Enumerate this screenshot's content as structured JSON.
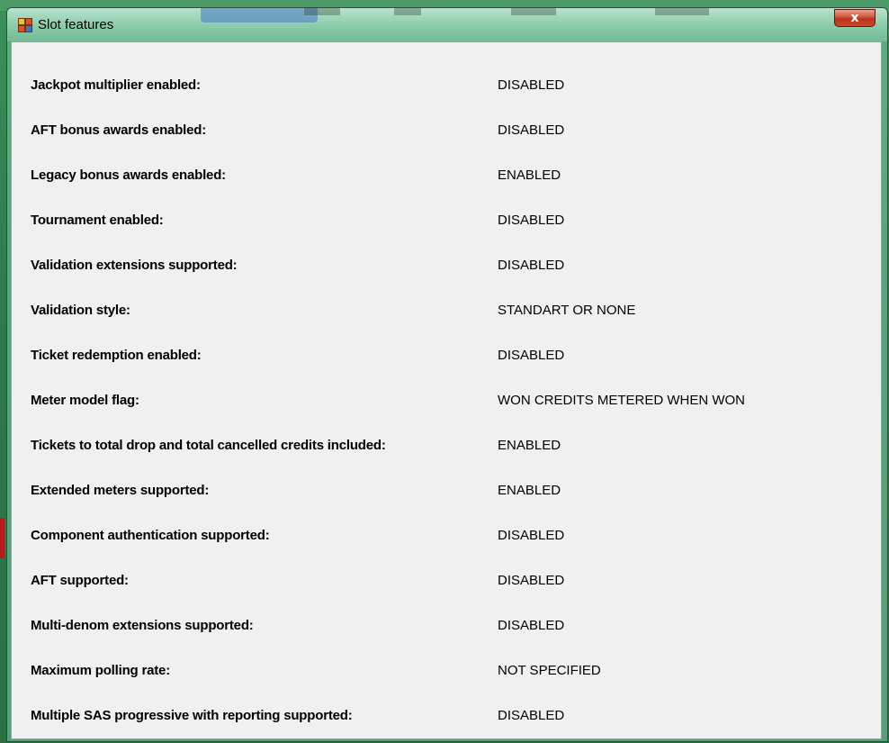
{
  "window": {
    "title": "Slot features",
    "close_label": "x"
  },
  "features": [
    {
      "label": "Jackpot multiplier enabled:",
      "value": "DISABLED"
    },
    {
      "label": "AFT bonus awards enabled:",
      "value": "DISABLED"
    },
    {
      "label": "Legacy bonus awards enabled:",
      "value": "ENABLED"
    },
    {
      "label": "Tournament enabled:",
      "value": "DISABLED"
    },
    {
      "label": "Validation extensions supported:",
      "value": "DISABLED"
    },
    {
      "label": "Validation style:",
      "value": "STANDART OR NONE"
    },
    {
      "label": "Ticket redemption enabled:",
      "value": "DISABLED"
    },
    {
      "label": "Meter model flag:",
      "value": "WON CREDITS METERED WHEN WON"
    },
    {
      "label": "Tickets to total drop and total cancelled credits included:",
      "value": "ENABLED"
    },
    {
      "label": "Extended meters supported:",
      "value": "ENABLED"
    },
    {
      "label": "Component authentication supported:",
      "value": "DISABLED"
    },
    {
      "label": "AFT supported:",
      "value": "DISABLED"
    },
    {
      "label": "Multi-denom extensions supported:",
      "value": "DISABLED"
    },
    {
      "label": "Maximum polling rate:",
      "value": "NOT SPECIFIED"
    },
    {
      "label": "Multiple SAS progressive with reporting supported:",
      "value": "DISABLED"
    }
  ],
  "icons": {
    "app": "app-window-icon",
    "close": "close-icon"
  }
}
